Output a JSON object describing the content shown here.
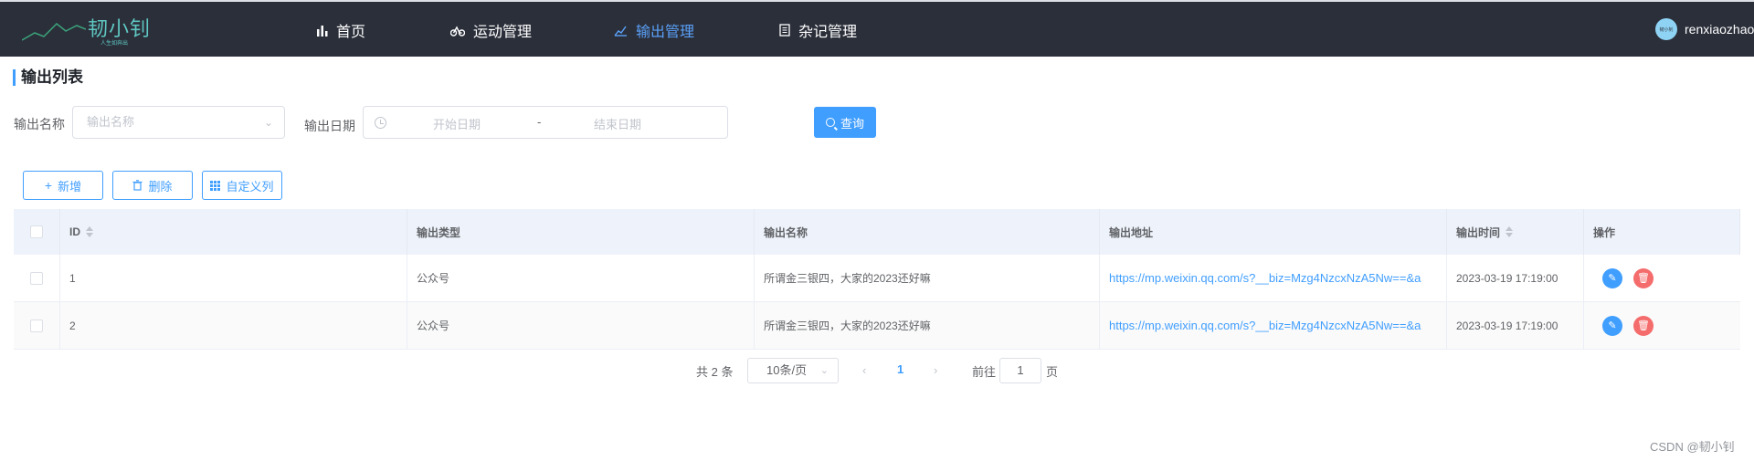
{
  "header": {
    "logo_text": "韧小钊",
    "logo_sub": "人生如奔出",
    "nav": [
      {
        "label": "首页",
        "icon": "bar-chart-icon",
        "active": false
      },
      {
        "label": "运动管理",
        "icon": "bicycle-icon",
        "active": false
      },
      {
        "label": "输出管理",
        "icon": "chart-edit-icon",
        "active": true
      },
      {
        "label": "杂记管理",
        "icon": "notebook-icon",
        "active": false
      }
    ],
    "username": "renxiaozhao",
    "avatar_text": "韧小钊"
  },
  "page_title": "输出列表",
  "search": {
    "name_label": "输出名称",
    "name_placeholder": "输出名称",
    "date_label": "输出日期",
    "start_placeholder": "开始日期",
    "separator": "-",
    "end_placeholder": "结束日期",
    "query_label": "查询"
  },
  "toolbar": {
    "add_label": "新增",
    "delete_label": "删除",
    "columns_label": "自定义列"
  },
  "table": {
    "columns": [
      "ID",
      "输出类型",
      "输出名称",
      "输出地址",
      "输出时间",
      "操作"
    ],
    "rows": [
      {
        "id": "1",
        "type": "公众号",
        "name": "所谓金三银四，大家的2023还好嘛",
        "url": "https://mp.weixin.qq.com/s?__biz=Mzg4NzcxNzA5Nw==&a",
        "time": "2023-03-19 17:19:00"
      },
      {
        "id": "2",
        "type": "公众号",
        "name": "所谓金三银四，大家的2023还好嘛",
        "url": "https://mp.weixin.qq.com/s?__biz=Mzg4NzcxNzA5Nw==&a",
        "time": "2023-03-19 17:19:00"
      }
    ]
  },
  "pagination": {
    "total": "共 2 条",
    "page_size": "10条/页",
    "current": "1",
    "goto_prefix": "前往",
    "goto_value": "1",
    "goto_suffix": "页"
  },
  "watermark": "CSDN @韧小钊",
  "colors": {
    "accent": "#409eff",
    "danger": "#f56c6c",
    "nav_bg": "#2b2f3a"
  }
}
